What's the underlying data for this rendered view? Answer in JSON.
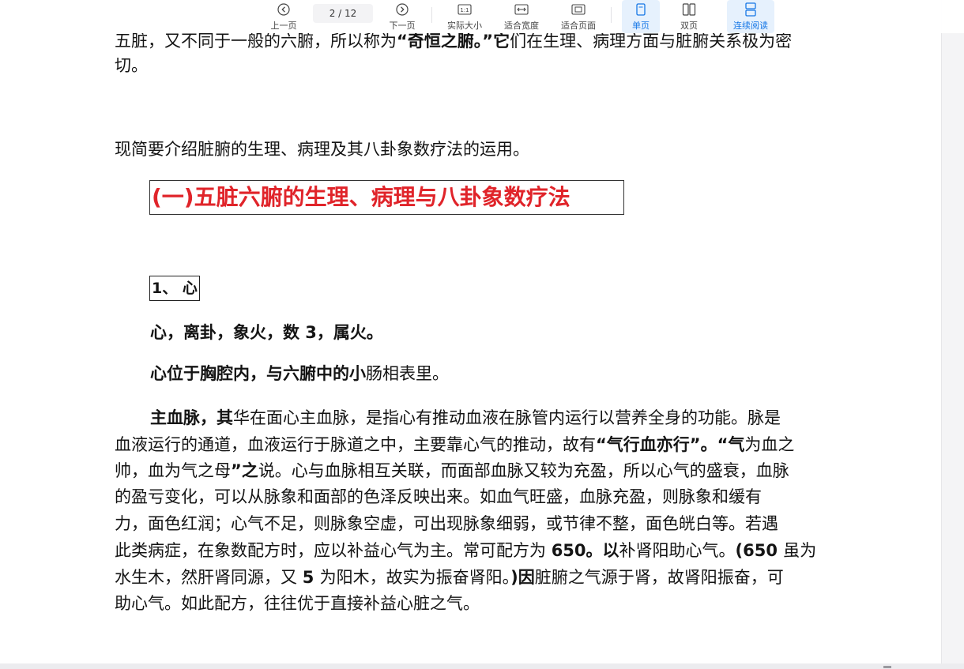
{
  "toolbar": {
    "prev_label": "上一页",
    "page_current": "2",
    "page_sep": "/",
    "page_total": "12",
    "next_label": "下一页",
    "actual_size_label": "实际大小",
    "fit_width_label": "适合宽度",
    "fit_page_label": "适合页面",
    "single_label": "单页",
    "double_label": "双页",
    "continuous_label": "连续阅读",
    "accent_color": "#1677e6"
  },
  "doc": {
    "top_line1_a": "五脏，又不同于一般的六腑，所以称为",
    "top_line1_b": "“奇恒之腑。”它",
    "top_line1_c": "们在生理、病理方面与脏腑关系极为密",
    "top_line2": "切。",
    "intro": "现简要介绍脏腑的生理、病理及其八卦象数疗法的运用。",
    "section_title": "(一)五脏六腑的生理、病理与八卦象数疗法",
    "sub_title": "1、 心",
    "attr_line": "心，离卦，象火，数 3，属火。",
    "pos_a": "心位于胸腔内，与六腑中的小",
    "pos_b": "肠相表里。",
    "para": [
      {
        "a": "主血脉，其",
        "b": "华在面心主血脉，是指心有推动血液在脉管内运行以营养全身的功能。脉是"
      },
      {
        "a": "血液运行的通道，血液运行于脉道之中，主要靠心气的推动，故有",
        "b": "“气行血亦行”。“气",
        "c": "为血之"
      },
      {
        "a": "帅，血为气之母",
        "b": "”之",
        "c": "说。心与血脉相互关联，而面部血脉又较为充盈，所以心气的盛衰，血脉"
      },
      {
        "a": "的盈亏变化，可以从脉象和面部的色泽反映出来。如血气旺盛，血脉充盈，则脉象和缓有"
      },
      {
        "a": "力，面色红润；心气不足，则脉象空虚，可出现脉象细弱，或节律不整，面色㿠白等。若遇"
      },
      {
        "a": "此类病症，在象数配方时，应以补益心气为主。常可配方为 ",
        "b": "650。以",
        "c": "补肾阳助心气。",
        "d": "(650 ",
        "e": "虽为"
      },
      {
        "a": "水生木，然肝肾同源，又 ",
        "b": "5 ",
        "c": "为阳木，故实为振奋肾阳。",
        "d": ")因",
        "e": "脏腑之气源于肾，故肾阳振奋，可"
      },
      {
        "a": "助心气。如此配方，往往优于直接补益心脏之气。"
      }
    ]
  }
}
